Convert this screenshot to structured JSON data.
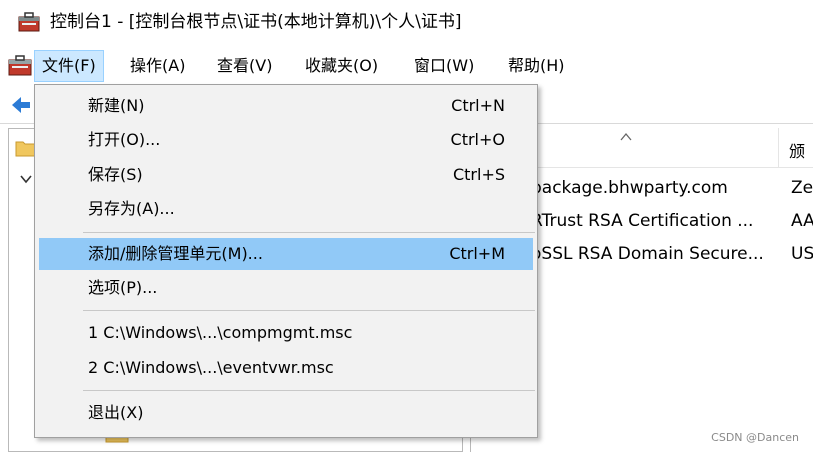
{
  "window": {
    "title": "控制台1 - [控制台根节点\\证书(本地计算机)\\个人\\证书]",
    "icons": {
      "app": "mmc-toolbox-icon",
      "doc": "mmc-doc-icon"
    }
  },
  "menubar": {
    "items": [
      {
        "label": "文件(F)",
        "active": true
      },
      {
        "label": "操作(A)"
      },
      {
        "label": "查看(V)"
      },
      {
        "label": "收藏夹(O)"
      },
      {
        "label": "窗口(W)"
      },
      {
        "label": "帮助(H)"
      }
    ]
  },
  "file_menu": {
    "items": [
      {
        "label": "新建(N)",
        "shortcut": "Ctrl+N"
      },
      {
        "label": "打开(O)...",
        "shortcut": "Ctrl+O"
      },
      {
        "label": "保存(S)",
        "shortcut": "Ctrl+S"
      },
      {
        "label": "另存为(A)...",
        "shortcut": ""
      },
      {
        "label": "添加/删除管理单元(M)...",
        "shortcut": "Ctrl+M",
        "highlighted": true
      },
      {
        "label": "选项(P)...",
        "shortcut": ""
      },
      {
        "label": "1 C:\\Windows\\...\\compmgmt.msc",
        "shortcut": ""
      },
      {
        "label": "2 C:\\Windows\\...\\eventvwr.msc",
        "shortcut": ""
      },
      {
        "label": "退出(X)",
        "shortcut": ""
      }
    ]
  },
  "cert_list": {
    "header_right": "颁",
    "rows": [
      {
        "issued_to": "package.bhwparty.com",
        "issued_by": "Ze"
      },
      {
        "issued_to": "RTrust RSA Certification ...",
        "issued_by": "AA"
      },
      {
        "issued_to": "oSSL RSA Domain Secure...",
        "issued_by": "US"
      }
    ]
  },
  "watermark": "CSDN @Dancen",
  "colors": {
    "highlight": "#91c9f7",
    "menu_bg": "#f2f2f2",
    "active_menu": "#cce8ff",
    "back_arrow": "#2b7bd6"
  }
}
